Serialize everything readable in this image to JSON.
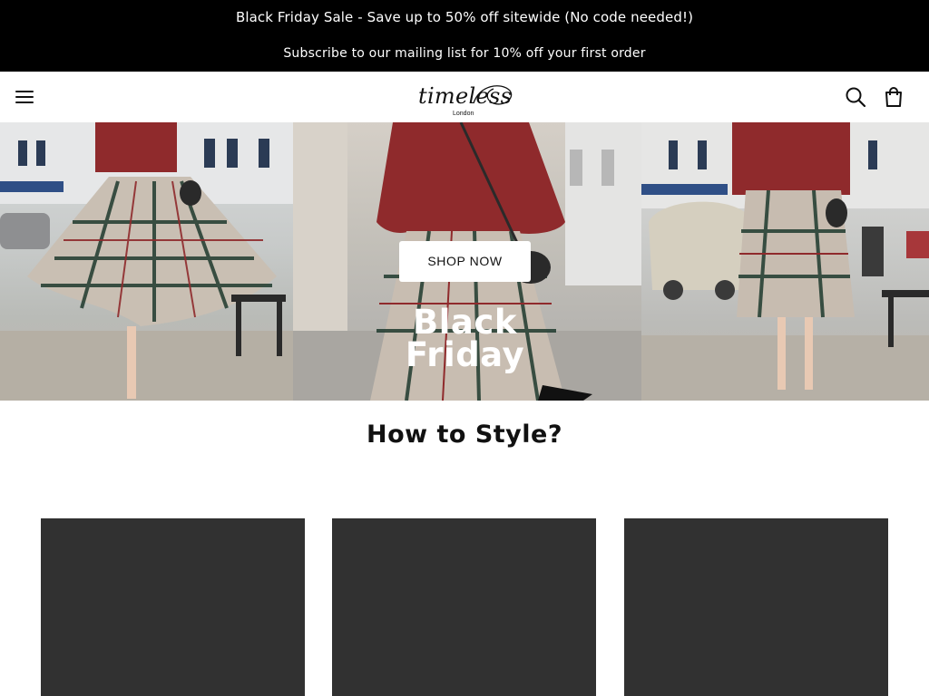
{
  "announcement": {
    "line1": "Black Friday Sale - Save up to 50% off sitewide (No code needed!)",
    "line2": "Subscribe to our mailing list for 10% off your first order",
    "background": "#000000",
    "text_color": "#ffffff"
  },
  "header": {
    "menu_icon": "hamburger-menu-icon",
    "logo_text": "timeless",
    "logo_subtext": "London",
    "search_icon": "search-icon",
    "cart_icon": "shopping-bag-icon"
  },
  "hero": {
    "button_label": "SHOP NOW",
    "overlay_line1": "Black",
    "overlay_line2": "Friday"
  },
  "style_section": {
    "title": "How to Style?",
    "card_color": "#313131"
  }
}
